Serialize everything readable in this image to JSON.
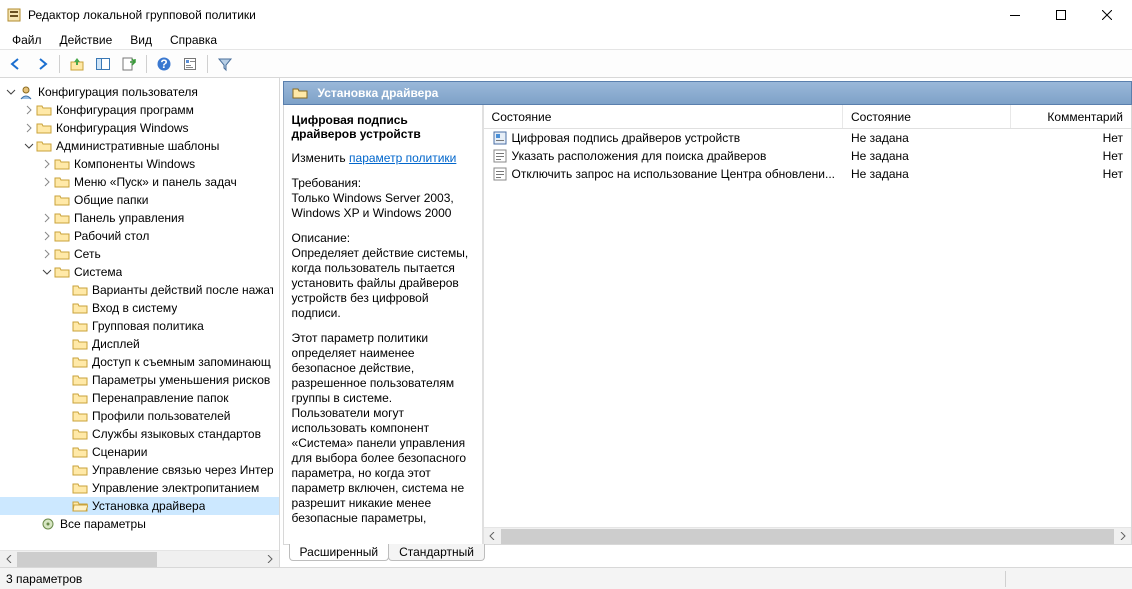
{
  "window": {
    "title": "Редактор локальной групповой политики"
  },
  "menu": {
    "file": "Файл",
    "action": "Действие",
    "view": "Вид",
    "help": "Справка"
  },
  "tree": {
    "user_config": "Конфигурация пользователя",
    "prog_config": "Конфигурация программ",
    "win_config": "Конфигурация Windows",
    "adm_templates": "Административные шаблоны",
    "comp_windows": "Компоненты Windows",
    "start_taskbar": "Меню «Пуск» и панель задач",
    "shared_folders": "Общие папки",
    "ctrl_panel": "Панель управления",
    "desktop": "Рабочий стол",
    "network": "Сеть",
    "system": "Система",
    "sys_poweractions": "Варианты действий после нажати",
    "sys_logon": "Вход в систему",
    "sys_gp": "Групповая политика",
    "sys_display": "Дисплей",
    "sys_removable": "Доступ к съемным запоминающ",
    "sys_mitigation": "Параметры уменьшения рисков",
    "sys_folderredir": "Перенаправление папок",
    "sys_userprofiles": "Профили пользователей",
    "sys_langstandards": "Службы языковых стандартов",
    "sys_scripts": "Сценарии",
    "sys_internetcomm": "Управление связью через Интерн",
    "sys_power": "Управление электропитанием",
    "sys_driverinstall": "Установка драйвера",
    "all_settings": "Все параметры"
  },
  "header": {
    "category": "Установка драйвера"
  },
  "desc": {
    "title": "Цифровая подпись драйверов устройств",
    "edit_prefix": "Изменить",
    "edit_link": "параметр политики",
    "req_label": "Требования:",
    "req_text": "Только Windows Server 2003, Windows XP и Windows 2000",
    "desc_label": "Описание:",
    "desc_text1": "Определяет действие системы, когда пользователь пытается установить файлы драйверов устройств без цифровой подписи.",
    "desc_text2": "Этот параметр политики определяет наименее безопасное действие, разрешенное пользователям группы в системе. Пользователи могут использовать компонент «Система» панели управления для выбора более безопасного параметра, но когда этот параметр включен, система не разрешит никакие менее безопасные параметры,"
  },
  "list": {
    "col_setting": "Состояние",
    "col_state": "Состояние",
    "col_comment": "Комментарий",
    "rows": [
      {
        "name": "Цифровая подпись драйверов устройств",
        "state": "Не задана",
        "comment": "Нет"
      },
      {
        "name": "Указать расположения для поиска драйверов",
        "state": "Не задана",
        "comment": "Нет"
      },
      {
        "name": "Отключить запрос на использование Центра обновлени...",
        "state": "Не задана",
        "comment": "Нет"
      }
    ]
  },
  "tabs": {
    "extended": "Расширенный",
    "standard": "Стандартный"
  },
  "status": {
    "count": "3 параметров"
  }
}
